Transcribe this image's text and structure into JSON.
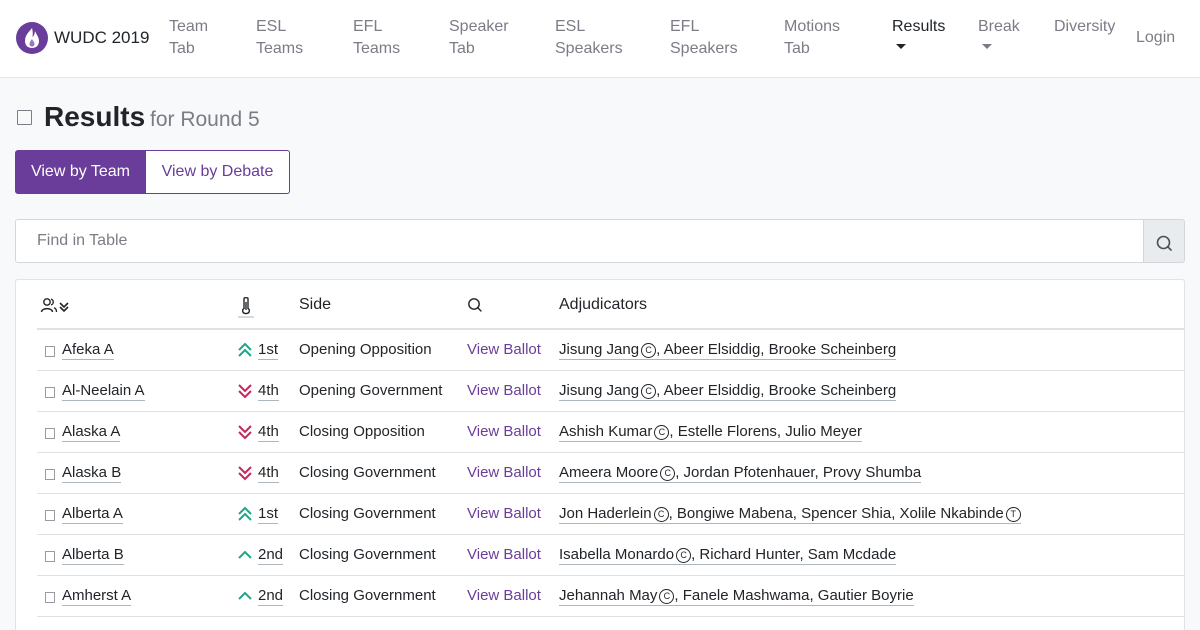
{
  "brand": {
    "name": "WUDC 2019"
  },
  "nav": {
    "team_tab": [
      "Team",
      "Tab"
    ],
    "esl_teams": [
      "ESL",
      "Teams"
    ],
    "efl_teams": [
      "EFL",
      "Teams"
    ],
    "speaker_tab": [
      "Speaker",
      "Tab"
    ],
    "esl_speakers": [
      "ESL",
      "Speakers"
    ],
    "efl_speakers": [
      "EFL",
      "Speakers"
    ],
    "motions_tab": [
      "Motions",
      "Tab"
    ],
    "results": "Results",
    "break": "Break",
    "diversity": "Diversity",
    "login": "Login"
  },
  "page": {
    "title": "Results",
    "subtitle": "for Round 5"
  },
  "toggle": {
    "by_team": "View by Team",
    "by_debate": "View by Debate"
  },
  "search": {
    "placeholder": "Find in Table"
  },
  "table": {
    "headers": {
      "side": "Side",
      "adjudicators": "Adjudicators"
    },
    "rows": [
      {
        "team": "Afeka A",
        "result": "1st",
        "trend": "double-up",
        "side": "Opening Opposition",
        "ballot": "View Ballot",
        "chair": "Jisung Jang",
        "chair_role": "C",
        "panel": ", Abeer Elsiddig, Brooke Scheinberg",
        "trainee": "",
        "trainee_role": ""
      },
      {
        "team": "Al-Neelain A",
        "result": "4th",
        "trend": "double-down",
        "side": "Opening Government",
        "ballot": "View Ballot",
        "chair": "Jisung Jang",
        "chair_role": "C",
        "panel": ", Abeer Elsiddig, Brooke Scheinberg",
        "trainee": "",
        "trainee_role": ""
      },
      {
        "team": "Alaska A",
        "result": "4th",
        "trend": "double-down",
        "side": "Closing Opposition",
        "ballot": "View Ballot",
        "chair": "Ashish Kumar",
        "chair_role": "C",
        "panel": ", Estelle Florens, Julio Meyer",
        "trainee": "",
        "trainee_role": ""
      },
      {
        "team": "Alaska B",
        "result": "4th",
        "trend": "double-down",
        "side": "Closing Government",
        "ballot": "View Ballot",
        "chair": "Ameera Moore",
        "chair_role": "C",
        "panel": ", Jordan Pfotenhauer, Provy Shumba",
        "trainee": "",
        "trainee_role": ""
      },
      {
        "team": "Alberta A",
        "result": "1st",
        "trend": "double-up",
        "side": "Closing Government",
        "ballot": "View Ballot",
        "chair": "Jon Haderlein",
        "chair_role": "C",
        "panel": ", Bongiwe Mabena, Spencer Shia, ",
        "trainee": "Xolile Nkabinde",
        "trainee_role": "T"
      },
      {
        "team": "Alberta B",
        "result": "2nd",
        "trend": "up",
        "side": "Closing Government",
        "ballot": "View Ballot",
        "chair": "Isabella Monardo",
        "chair_role": "C",
        "panel": ", Richard Hunter, Sam Mcdade",
        "trainee": "",
        "trainee_role": ""
      },
      {
        "team": "Amherst A",
        "result": "2nd",
        "trend": "up",
        "side": "Closing Government",
        "ballot": "View Ballot",
        "chair": "Jehannah May",
        "chair_role": "C",
        "panel": ", Fanele Mashwama, Gautier Boyrie",
        "trainee": "",
        "trainee_role": ""
      }
    ]
  },
  "colors": {
    "accent": "#6a3d9a",
    "up": "#20a58a",
    "down": "#c4275e"
  },
  "icons": {
    "team_sort": "users-sort-icon",
    "result": "thermometer-icon",
    "ballot_search": "search-icon"
  }
}
